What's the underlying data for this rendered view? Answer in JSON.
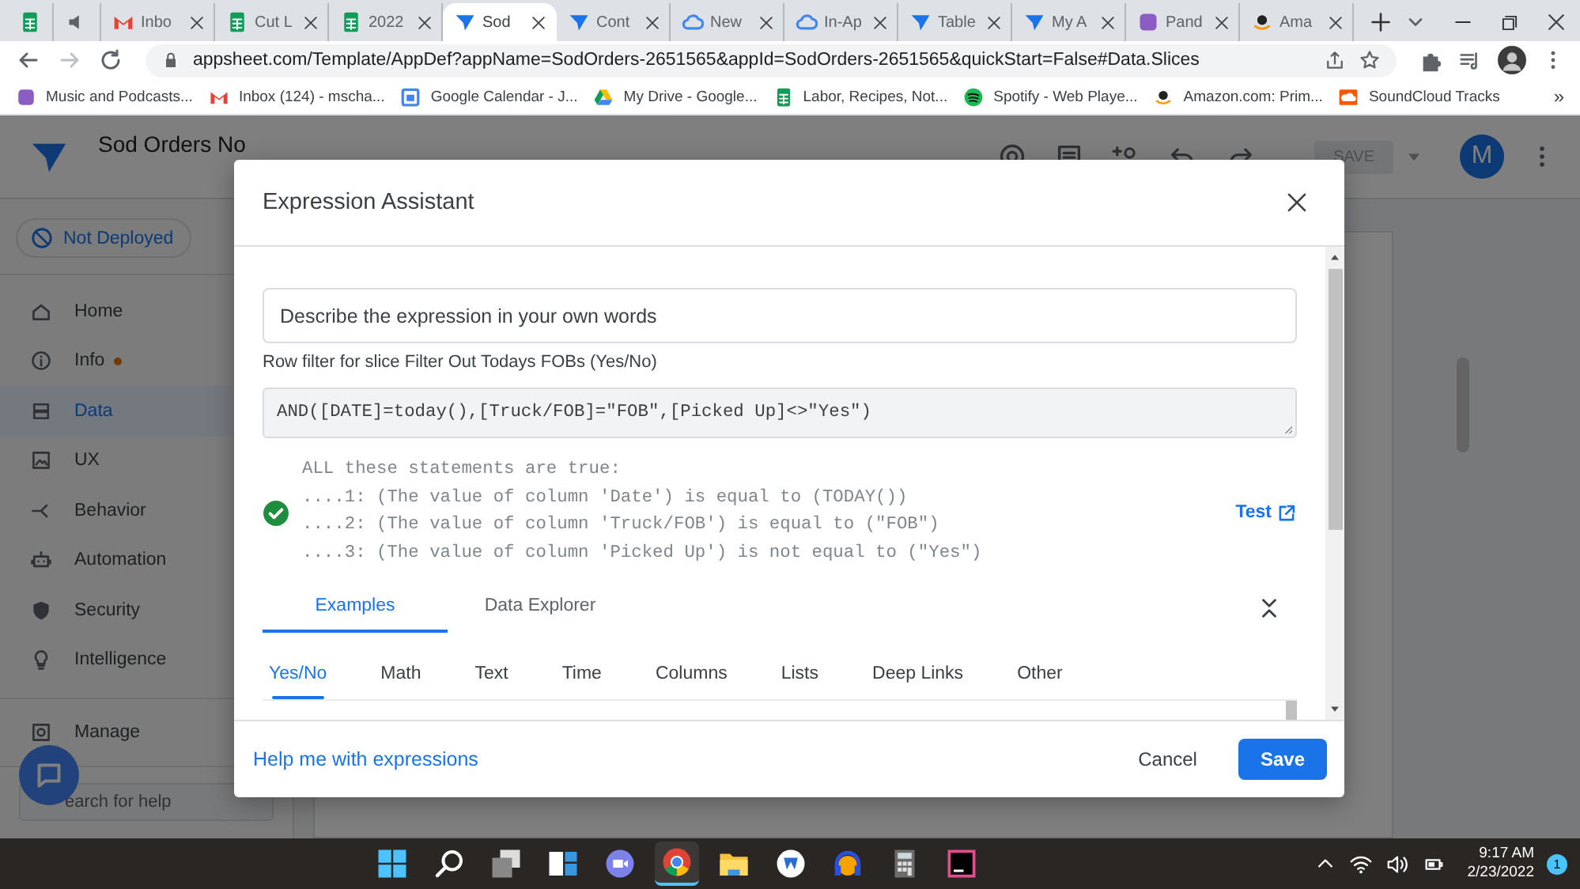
{
  "browser": {
    "tabs": [
      {
        "kind": "sheets",
        "selected": false
      },
      {
        "kind": "audio",
        "selected": false
      },
      {
        "kind": "gmail",
        "title": "Inbo",
        "selected": false
      },
      {
        "kind": "sheets",
        "title": "Cut L",
        "selected": false
      },
      {
        "kind": "sheets",
        "title": "2022",
        "selected": false
      },
      {
        "kind": "appsheet",
        "title": "Sod",
        "selected": true
      },
      {
        "kind": "appsheet",
        "title": "Cont",
        "selected": false
      },
      {
        "kind": "cloud",
        "title": "New",
        "selected": false
      },
      {
        "kind": "cloud",
        "title": "In-Ap",
        "selected": false
      },
      {
        "kind": "appsheet",
        "title": "Table",
        "selected": false
      },
      {
        "kind": "appsheet",
        "title": "My A",
        "selected": false
      },
      {
        "kind": "pandora",
        "title": "Pand",
        "selected": false
      },
      {
        "kind": "amazon",
        "title": "Ama",
        "selected": false
      }
    ],
    "address": "appsheet.com/Template/AppDef?appName=SodOrders-2651565&appId=SodOrders-2651565&quickStart=False#Data.Slices",
    "bookmarks": [
      {
        "kind": "pandora",
        "label": "Music and Podcasts..."
      },
      {
        "kind": "gmail",
        "label": "Inbox (124) - mscha..."
      },
      {
        "kind": "calendar",
        "label": "Google Calendar - J..."
      },
      {
        "kind": "drive",
        "label": "My Drive - Google..."
      },
      {
        "kind": "sheets",
        "label": "Labor, Recipes, Not..."
      },
      {
        "kind": "spotify",
        "label": "Spotify - Web Playe..."
      },
      {
        "kind": "amazon",
        "label": "Amazon.com: Prim..."
      },
      {
        "kind": "soundcloud",
        "label": "SoundCloud Tracks"
      }
    ],
    "bookmarks_more": "»"
  },
  "app": {
    "title": "Sod Orders No",
    "save_label": "SAVE",
    "avatar": "M",
    "status": "Not Deployed",
    "nav": [
      {
        "label": "Home",
        "selected": false,
        "dot": false
      },
      {
        "label": "Info",
        "selected": false,
        "dot": true
      },
      {
        "label": "Data",
        "selected": true,
        "dot": false
      },
      {
        "label": "UX",
        "selected": false,
        "dot": false
      },
      {
        "label": "Behavior",
        "selected": false,
        "dot": false
      },
      {
        "label": "Automation",
        "selected": false,
        "dot": false
      },
      {
        "label": "Security",
        "selected": false,
        "dot": false
      },
      {
        "label": "Intelligence",
        "selected": false,
        "dot": false
      }
    ],
    "manage": {
      "label": "Manage",
      "selected": false
    },
    "search": {
      "placeholder": "earch for help"
    }
  },
  "dialog": {
    "title": "Expression Assistant",
    "description": {
      "placeholder": "Describe the expression in your own words"
    },
    "hint": "Row filter for slice Filter Out Todays FOBs (Yes/No)",
    "expression": "AND([DATE]=today(),[Truck/FOB]=\"FOB\",[Picked Up]<>\"Yes\")",
    "valid": true,
    "explanation": [
      "ALL these statements are true:",
      "....1: (The value of column 'Date') is equal to (TODAY())",
      "....2: (The value of column 'Truck/FOB') is equal to (\"FOB\")",
      "....3: (The value of column 'Picked Up') is not equal to (\"Yes\")"
    ],
    "test_link": "Test",
    "tabs": [
      {
        "label": "Examples",
        "selected": true
      },
      {
        "label": "Data Explorer",
        "selected": false
      }
    ],
    "categories": [
      {
        "label": "Yes/No",
        "selected": true
      },
      {
        "label": "Math",
        "selected": false
      },
      {
        "label": "Text",
        "selected": false
      },
      {
        "label": "Time",
        "selected": false
      },
      {
        "label": "Columns",
        "selected": false
      },
      {
        "label": "Lists",
        "selected": false
      },
      {
        "label": "Deep Links",
        "selected": false
      },
      {
        "label": "Other",
        "selected": false
      }
    ],
    "help_link": "Help me with expressions",
    "cancel": "Cancel",
    "save": "Save"
  },
  "taskbar": {
    "apps": [
      {
        "selected": false
      },
      {
        "selected": false
      },
      {
        "selected": false
      },
      {
        "selected": false
      },
      {
        "selected": false
      },
      {
        "selected": true
      },
      {
        "selected": false
      },
      {
        "selected": false
      },
      {
        "selected": false
      },
      {
        "selected": false
      },
      {
        "selected": false
      }
    ],
    "time": "9:17 AM",
    "date": "2/23/2022",
    "notifications": "1"
  }
}
